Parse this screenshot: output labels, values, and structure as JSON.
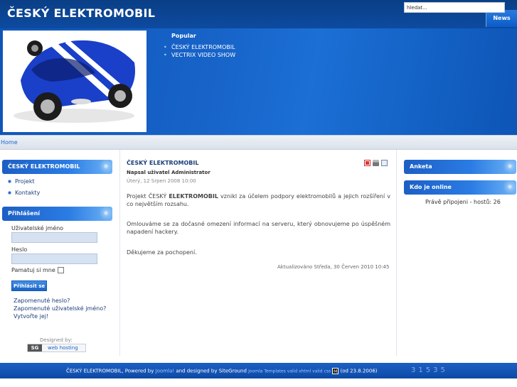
{
  "header": {
    "title": "ČESKÝ ELEKTROMOBIL",
    "news_tab": "News"
  },
  "banner": {
    "popular_title": "Popular",
    "popular_items": [
      "ČESKÝ ELEKTROMOBIL",
      "VECTRIX VIDEO SHOW"
    ],
    "photo_icon": "blue-sports-car-photo"
  },
  "breadcrumb": {
    "home": "Home"
  },
  "search": {
    "value": "hledat..."
  },
  "left": {
    "menu_title": "ČESKÝ ELEKTROMOBIL",
    "menu_items": [
      "Projekt",
      "Kontakty"
    ],
    "login_title": "Přihlášení",
    "username_label": "Uživatelské jméno",
    "password_label": "Heslo",
    "remember_label": "Pamatuj si mne",
    "login_button": "Přihlásit se",
    "links": [
      "Zapomenuté heslo?",
      "Zapomenuté uživatelské jméno?",
      "Vytvořte jej!"
    ],
    "designed_by": "Designed by:",
    "badge_sg": "SG",
    "badge_text": "web hosting"
  },
  "article": {
    "title": "ČESKÝ ELEKTROMOBIL",
    "author": "Napsal uživatel Administrator",
    "date": "Úterý, 12 Srpen 2008 10:00",
    "p1_pre": "Projekt ČESKÝ ",
    "p1_bold": "ELEKTROMOBIL",
    "p1_post": " vznikl za účelem podpory elektromobilů a jejich rozšíření v co největším rozsahu.",
    "p2": "Omlouváme se za dočasné omezení informací na serveru, který obnovujeme po úspěšném napadení hackery.",
    "p3": "Děkujeme za pochopení.",
    "modified": "Aktualizováno Středa, 30 Červen 2010 10:45",
    "icons": [
      "pdf-icon",
      "print-icon",
      "email-icon"
    ]
  },
  "right": {
    "poll_title": "Anketa",
    "online_title": "Kdo je online",
    "online_text": "Právě připojeni - hostů: 26"
  },
  "footer": {
    "text1": "ČESKÝ ELEKTROMOBIL, Powered by ",
    "joomla": "Joomla!",
    "text2": " and designed by SiteGround ",
    "templates": "Joomla Templates valid xhtml valid css",
    "m_icon": "M",
    "text3": " (od 23.8.2006)",
    "counter": "31535"
  },
  "colors": {
    "brand_blue": "#0d4aa0",
    "link_blue": "#1b64c8",
    "module_blue": "#2a7ce4"
  }
}
